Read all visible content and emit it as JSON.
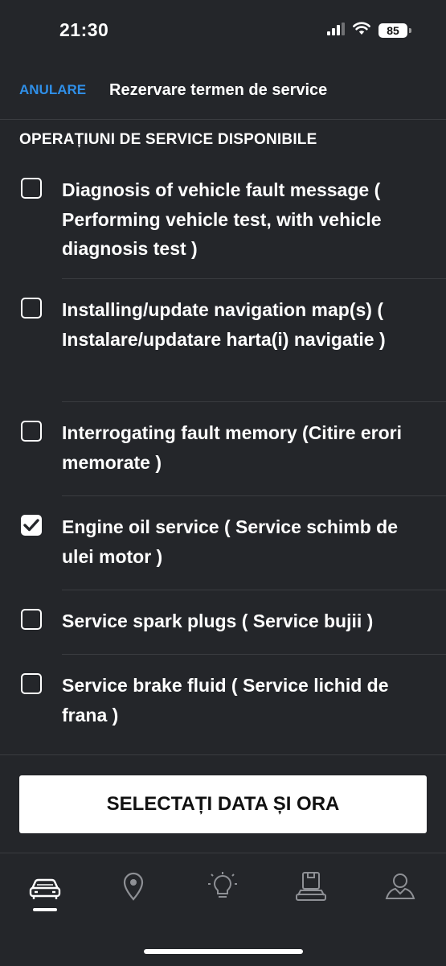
{
  "status_bar": {
    "time": "21:30",
    "battery": "85"
  },
  "header": {
    "cancel_label": "ANULARE",
    "title": "Rezervare termen de service"
  },
  "section_title": "OPERAȚIUNI DE SERVICE DISPONIBILE",
  "services": [
    {
      "label": "Diagnosis of vehicle fault message ( Performing vehicle test, with vehicle diagnosis test )",
      "checked": false
    },
    {
      "label": "Installing/update navigation map(s) ( Instalare/updatare harta(i) navigatie )",
      "checked": false
    },
    {
      "label": "Interrogating fault memory (Citire erori memorate )",
      "checked": false
    },
    {
      "label": "Engine oil service ( Service schimb de ulei motor )",
      "checked": true
    },
    {
      "label": "Service spark plugs ( Service bujii )",
      "checked": false
    },
    {
      "label": "Service brake fluid ( Service lichid de frana )",
      "checked": false
    }
  ],
  "cta_label": "SELECTAȚI DATA ȘI ORA",
  "tabs": [
    {
      "icon": "car-icon",
      "active": true
    },
    {
      "icon": "location-pin-icon",
      "active": false
    },
    {
      "icon": "lightbulb-icon",
      "active": false
    },
    {
      "icon": "car-service-icon",
      "active": false
    },
    {
      "icon": "profile-icon",
      "active": false
    }
  ],
  "colors": {
    "background": "#24262a",
    "accent": "#2f8fe8",
    "text": "#ffffff"
  }
}
